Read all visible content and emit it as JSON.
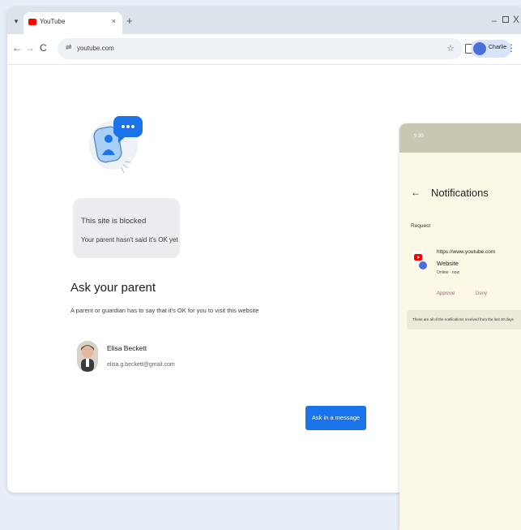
{
  "browser": {
    "tab": {
      "title": "YouTube",
      "close": "×"
    },
    "new_tab": "+",
    "window_controls": {
      "minimize": "–",
      "close": "X"
    },
    "nav": {
      "back": "←",
      "forward": "→",
      "reload": "C"
    },
    "url": "youtube.com",
    "profile_name": "Charlie",
    "menu": "⋮",
    "icons": [
      "tab-search-icon",
      "site-info-icon",
      "star-icon",
      "extensions-icon",
      "side-panel-icon"
    ]
  },
  "blocked": {
    "title": "This site is blocked",
    "subtitle": "Your parent hasn't said it's OK yet"
  },
  "ask": {
    "title": "Ask your parent",
    "subtitle": "A parent or guardian has to say that it's OK for you to visit this website",
    "parent_name": "Elisa Beckett",
    "parent_email": "elisa.g.beckett@gmail.com",
    "button_label": "Ask in a message"
  },
  "phone": {
    "time": "9:30",
    "title": "Notifications",
    "back": "←",
    "section": "Request",
    "request": {
      "url": "https://www.youtube.com",
      "type": "Website",
      "meta": "Online · now",
      "approve": "Approve",
      "deny": "Deny"
    },
    "footer": "These are all of the notifications received from the last 30 days"
  },
  "colors": {
    "accent": "#1a73e8",
    "youtube_red": "#ff0000",
    "phone_bg": "#fbf8e6",
    "action_text": "#9a6b74"
  }
}
